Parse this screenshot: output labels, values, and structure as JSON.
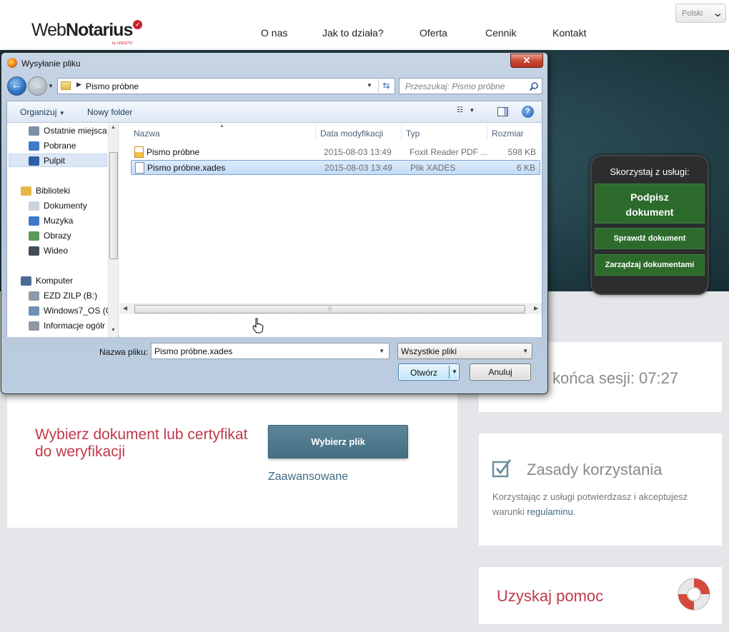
{
  "site": {
    "logo": {
      "prefix": "Web",
      "name": "Notarius",
      "sub": "by UNIZETO"
    },
    "nav": [
      "O nas",
      "Jak to działa?",
      "Oferta",
      "Cennik",
      "Kontakt"
    ],
    "language": "Polski",
    "service_panel": {
      "title": "Skorzystaj z usługi:",
      "sign_button": "Podpisz dokument",
      "verify_button": "Sprawdź dokument",
      "manage_button": "Zarządzaj dokumentami"
    },
    "main_card": {
      "prompt": "Wybierz dokument lub certyfikat do weryfikacji",
      "choose_button": "Wybierz plik",
      "advanced_link": "Zaawansowane"
    },
    "session": {
      "text": "końca sesji: 07:27"
    },
    "rules": {
      "title": "Zasady korzystania",
      "text": "Korzystając z usługi potwierdzasz i akceptujesz warunki",
      "link": "regulaminu",
      "suffix": "."
    },
    "help": {
      "title": "Uzyskaj pomoc"
    },
    "colors": {
      "accent_red": "#c0394b",
      "hero_teal": "#2a4b54",
      "service_green": "#2d6b2d",
      "button_steel": "#4f7a8e"
    }
  },
  "dialog": {
    "title": "Wysyłanie pliku",
    "close_symbol": "✕",
    "address": "Pismo próbne",
    "search_placeholder": "Przeszukaj: Pismo próbne",
    "toolbar": {
      "organize": "Organizuj",
      "new_folder": "Nowy folder"
    },
    "nav_tree": [
      {
        "label": "Ostatnie miejsca",
        "icon": "recent-places-icon"
      },
      {
        "label": "Pobrane",
        "icon": "downloads-icon"
      },
      {
        "label": "Pulpit",
        "icon": "desktop-icon",
        "selected": true
      },
      {
        "label": "Biblioteki",
        "icon": "libraries-icon"
      },
      {
        "label": "Dokumenty",
        "icon": "documents-icon"
      },
      {
        "label": "Muzyka",
        "icon": "music-icon"
      },
      {
        "label": "Obrazy",
        "icon": "pictures-icon"
      },
      {
        "label": "Wideo",
        "icon": "video-icon"
      },
      {
        "label": "Komputer",
        "icon": "computer-icon"
      },
      {
        "label": "EZD ZILP (B:)",
        "icon": "network-drive-icon"
      },
      {
        "label": "Windows7_OS (C",
        "icon": "system-drive-icon"
      },
      {
        "label": "Informacje ogólr",
        "icon": "network-drive-icon"
      }
    ],
    "columns": [
      "Nazwa",
      "Data modyfikacji",
      "Typ",
      "Rozmiar"
    ],
    "files": [
      {
        "name": "Pismo próbne",
        "date": "2015-08-03 13:49",
        "type": "Foxit Reader PDF ...",
        "size": "598 KB",
        "icon": "pdf-file-icon"
      },
      {
        "name": "Pismo próbne.xades",
        "date": "2015-08-03 13:49",
        "type": "Plik XADES",
        "size": "6 KB",
        "icon": "generic-file-icon",
        "selected": true
      }
    ],
    "filename_label": "Nazwa pliku:",
    "filename_value": "Pismo próbne.xades",
    "filetype": "Wszystkie pliki",
    "open_button": "Otwórz",
    "cancel_button": "Anuluj"
  }
}
